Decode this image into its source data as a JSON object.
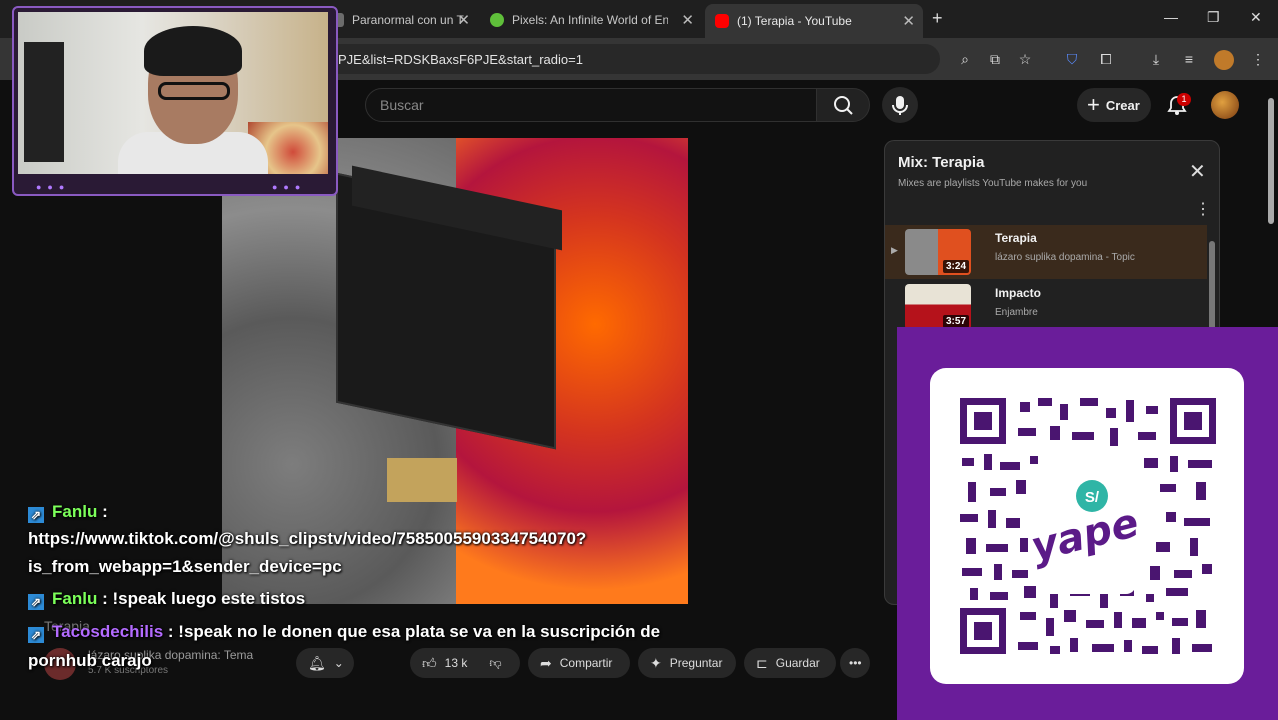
{
  "browser": {
    "tabs": [
      {
        "title": "Paranormal con un T",
        "favicon_color": "#6c6c6c",
        "active": false
      },
      {
        "title": "Pixels: An Infinite World of Endl",
        "favicon_color": "#5fbf3a",
        "active": false
      },
      {
        "title": "(1) Terapia - YouTube",
        "favicon_color": "#ff0000",
        "active": true
      }
    ],
    "url": "PJE&list=RDSKBaxsF6PJE&start_radio=1"
  },
  "youtube": {
    "search_placeholder": "Buscar",
    "create_label": "Crear",
    "notification_count": "1"
  },
  "chat": [
    {
      "user": "Fanlu",
      "user_color": "#7cff5a",
      "sep": " :",
      "message": ""
    },
    {
      "user": "",
      "user_color": "",
      "sep": "",
      "message": "https://www.tiktok.com/@shuls_clipstv/video/7585005590334754070?"
    },
    {
      "user": "",
      "user_color": "",
      "sep": "",
      "message": "is_from_webapp=1&sender_device=pc"
    },
    {
      "user": "Fanlu",
      "user_color": "#7cff5a",
      "sep": " : ",
      "message": "!speak luego este tistos"
    },
    {
      "user": "Tacosdechilis",
      "user_color": "#b36bff",
      "sep": " : ",
      "message": "!speak no le donen que esa plata se va en la suscripción de"
    },
    {
      "user": "",
      "user_color": "",
      "sep": "",
      "message": "pornhub carajo"
    }
  ],
  "video_meta": {
    "title": "Terapia",
    "channel": "lázaro suplika dopamina: Tema",
    "subscribers": "5.7 K suscriptores",
    "likes": "13 k",
    "share": "Compartir",
    "ask": "Preguntar",
    "save": "Guardar"
  },
  "mix": {
    "title": "Mix: Terapia",
    "subtitle": "Mixes are playlists YouTube makes for you",
    "items": [
      {
        "title": "Terapia",
        "artist": "lázaro suplika dopamina - Topic",
        "duration": "3:24",
        "active": true
      },
      {
        "title": "Impacto",
        "artist": "Enjambre",
        "duration": "3:57",
        "active": false
      }
    ]
  },
  "qr": {
    "brand": "yape",
    "currency": "S/",
    "brand_color": "#6a1d9a"
  }
}
